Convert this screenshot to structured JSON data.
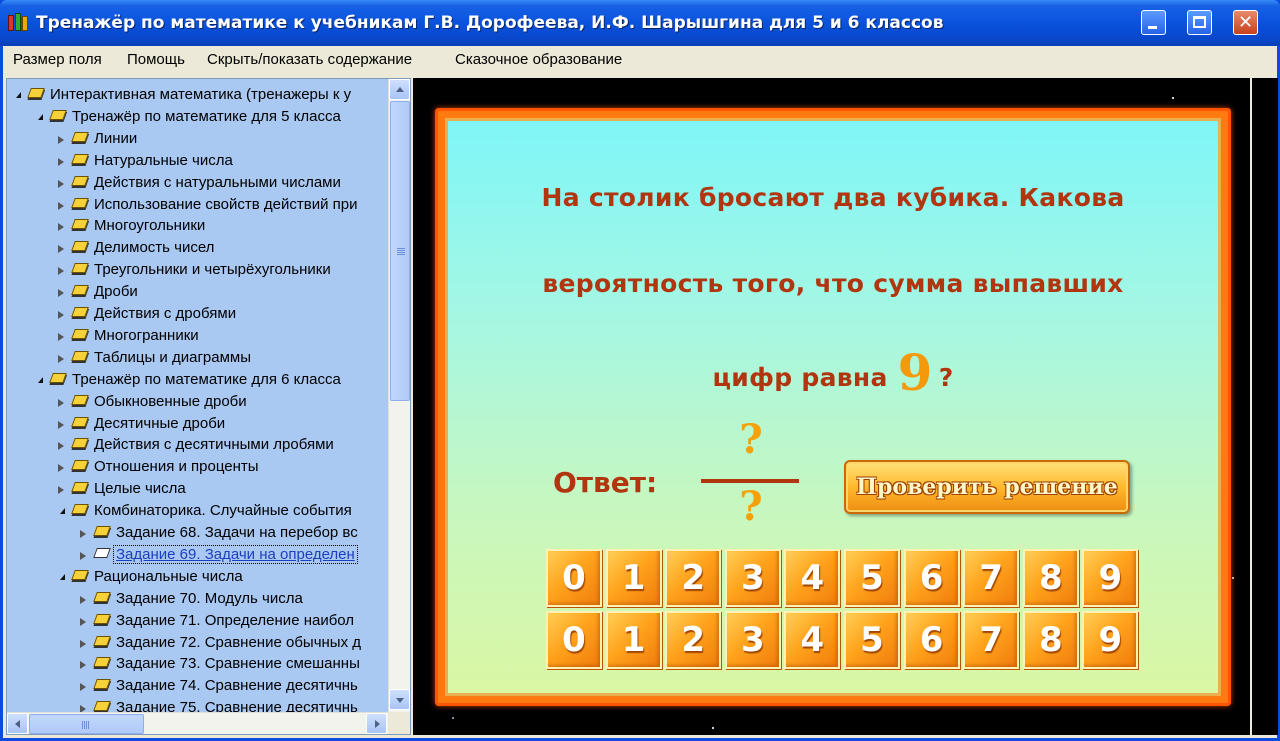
{
  "window": {
    "title": "Тренажёр по математике к учебникам Г.В. Дорофеева, И.Ф. Шарышгина для 5 и 6 классов",
    "close_glyph": "✕"
  },
  "menu": [
    "Размер поля",
    "Помощь",
    "Скрыть/показать содержание",
    "Сказочное образование"
  ],
  "tree": [
    {
      "level": 0,
      "expander": "open",
      "book": "closed",
      "label": "Интерактивная математика (тренажеры к у"
    },
    {
      "level": 1,
      "expander": "open",
      "book": "closed",
      "label": "Тренажёр по математике для 5 класса"
    },
    {
      "level": 2,
      "expander": "closed",
      "book": "closed",
      "label": "Линии"
    },
    {
      "level": 2,
      "expander": "closed",
      "book": "closed",
      "label": "Натуральные числа"
    },
    {
      "level": 2,
      "expander": "closed",
      "book": "closed",
      "label": "Действия с натуральными числами"
    },
    {
      "level": 2,
      "expander": "closed",
      "book": "closed",
      "label": "Использование свойств действий при"
    },
    {
      "level": 2,
      "expander": "closed",
      "book": "closed",
      "label": "Многоугольники"
    },
    {
      "level": 2,
      "expander": "closed",
      "book": "closed",
      "label": "Делимость чисел"
    },
    {
      "level": 2,
      "expander": "closed",
      "book": "closed",
      "label": "Треугольники и четырёхугольники"
    },
    {
      "level": 2,
      "expander": "closed",
      "book": "closed",
      "label": "Дроби"
    },
    {
      "level": 2,
      "expander": "closed",
      "book": "closed",
      "label": "Действия с дробями"
    },
    {
      "level": 2,
      "expander": "closed",
      "book": "closed",
      "label": "Многогранники"
    },
    {
      "level": 2,
      "expander": "closed",
      "book": "closed",
      "label": "Таблицы и диаграммы"
    },
    {
      "level": 1,
      "expander": "open",
      "book": "closed",
      "label": "Тренажёр по математике для 6 класса"
    },
    {
      "level": 2,
      "expander": "closed",
      "book": "closed",
      "label": "Обыкновенные дроби"
    },
    {
      "level": 2,
      "expander": "closed",
      "book": "closed",
      "label": "Десятичные дроби"
    },
    {
      "level": 2,
      "expander": "closed",
      "book": "closed",
      "label": "Действия с десятичными лробями"
    },
    {
      "level": 2,
      "expander": "closed",
      "book": "closed",
      "label": "Отношения и проценты"
    },
    {
      "level": 2,
      "expander": "closed",
      "book": "closed",
      "label": "Целые числа"
    },
    {
      "level": 2,
      "expander": "open",
      "book": "closed",
      "label": "Комбинаторика. Случайные события"
    },
    {
      "level": 3,
      "expander": "closed",
      "book": "closed",
      "label": "Задание 68. Задачи на перебор вс"
    },
    {
      "level": 3,
      "expander": "closed",
      "book": "open",
      "label": "Задание 69. Задачи на определен",
      "selected": true
    },
    {
      "level": 2,
      "expander": "open",
      "book": "closed",
      "label": "Рациональные числа"
    },
    {
      "level": 3,
      "expander": "closed",
      "book": "closed",
      "label": "Задание 70. Модуль числа"
    },
    {
      "level": 3,
      "expander": "closed",
      "book": "closed",
      "label": "Задание 71. Определение наибол"
    },
    {
      "level": 3,
      "expander": "closed",
      "book": "closed",
      "label": "Задание 72. Сравнение обычных д"
    },
    {
      "level": 3,
      "expander": "closed",
      "book": "closed",
      "label": "Задание 73. Сравнение смешанны"
    },
    {
      "level": 3,
      "expander": "closed",
      "book": "closed",
      "label": "Задание 74. Сравнение десятичнь"
    },
    {
      "level": 3,
      "expander": "closed",
      "book": "closed",
      "label": "Задание 75. Сравнение десятичнь"
    }
  ],
  "exercise": {
    "question_line1": "На столик бросают два кубика. Какова",
    "question_line2": "вероятность того, что сумма выпавших",
    "question_line3": "цифр равна",
    "question_number": "9",
    "question_mark": "?",
    "answer_label": "Ответ:",
    "numerator": "?",
    "denominator": "?",
    "check_button": "Проверить решение",
    "digits_row1": [
      "0",
      "1",
      "2",
      "3",
      "4",
      "5",
      "6",
      "7",
      "8",
      "9"
    ],
    "digits_row2": [
      "0",
      "1",
      "2",
      "3",
      "4",
      "5",
      "6",
      "7",
      "8",
      "9"
    ]
  },
  "colors": {
    "question_text": "#b1350e",
    "highlight_number": "#f49a0a",
    "frame": "#ff7b0f",
    "tree_background": "#a9c8f2"
  }
}
